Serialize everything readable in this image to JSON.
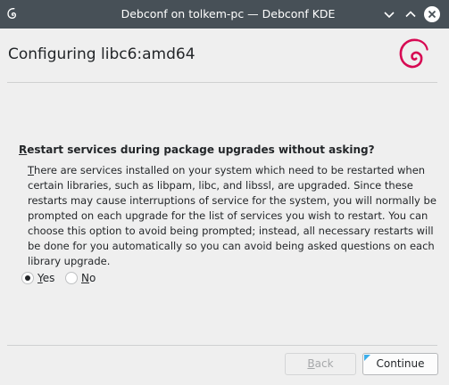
{
  "window": {
    "title": "Debconf on tolkem-pc — Debconf KDE",
    "app_icon": "debian-swirl-icon",
    "controls": [
      "minimize-icon",
      "maximize-icon",
      "close-icon"
    ]
  },
  "header": {
    "heading": "Configuring libc6:amd64",
    "logo": "debian-swirl-logo"
  },
  "question": {
    "mnemonic": "R",
    "text_rest": "estart services during package upgrades without asking?"
  },
  "description": {
    "first_letter": "T",
    "text_rest": "here are services installed on your system which need to be restarted when certain libraries, such as libpam, libc, and libssl, are upgraded. Since these restarts may cause interruptions of service for the system, you will normally be prompted on each upgrade for the list of services you wish to restart.  You can choose this option to avoid being prompted; instead, all necessary restarts will be done for you automatically so you can avoid being asked questions on each library upgrade."
  },
  "options": {
    "yes": {
      "mnemonic": "Y",
      "rest": "es",
      "selected": true
    },
    "no": {
      "mnemonic": "N",
      "rest": "o",
      "selected": false
    }
  },
  "buttons": {
    "back": {
      "mnemonic": "B",
      "rest": "ack",
      "enabled": false
    },
    "continue": {
      "label": "Continue"
    }
  },
  "colors": {
    "titlebar": "#475057",
    "window_bg": "#efefef",
    "debian_red": "#d70a53",
    "focus_accent": "#3daee9"
  }
}
